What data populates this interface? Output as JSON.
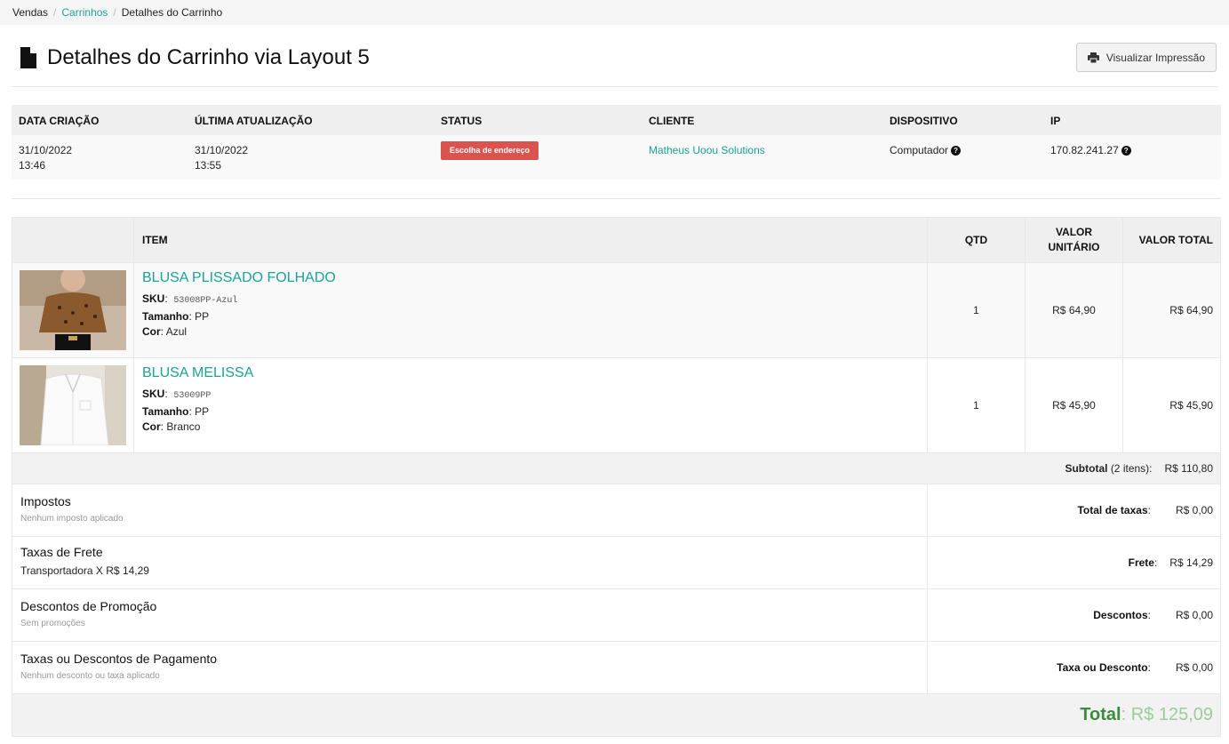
{
  "breadcrumb": {
    "item1": "Vendas",
    "item2": "Carrinhos",
    "item3": "Detalhes do Carrinho"
  },
  "header": {
    "title": "Detalhes do Carrinho via Layout 5",
    "print_label": "Visualizar Impressão",
    "title_icon": "file-icon",
    "print_icon": "printer-icon"
  },
  "info": {
    "headers": {
      "created": "DATA CRIAÇÃO",
      "updated": "ÚLTIMA ATUALIZAÇÃO",
      "status": "STATUS",
      "client": "CLIENTE",
      "device": "DISPOSITIVO",
      "ip": "IP"
    },
    "created_date": "31/10/2022",
    "created_time": "13:46",
    "updated_date": "31/10/2022",
    "updated_time": "13:55",
    "status": "Escolha de endereço",
    "status_color": "#d9534f",
    "client": "Matheus Uoou Solutions",
    "device": "Computador",
    "ip": "170.82.241.27"
  },
  "table": {
    "headers": {
      "item": "ITEM",
      "qtd": "QTD",
      "unit": "VALOR UNITÁRIO",
      "total": "VALOR TOTAL"
    },
    "items": [
      {
        "name": "BLUSA PLISSADO FOLHADO",
        "sku_label": "SKU",
        "sku": "53008PP-Azul",
        "size_label": "Tamanho",
        "size": "PP",
        "color_label": "Cor",
        "color": "Azul",
        "qtd": "1",
        "unit": "R$ 64,90",
        "total": "R$ 64,90"
      },
      {
        "name": "BLUSA MELISSA",
        "sku_label": "SKU",
        "sku": "53009PP",
        "size_label": "Tamanho",
        "size": "PP",
        "color_label": "Cor",
        "color": "Branco",
        "qtd": "1",
        "unit": "R$ 45,90",
        "total": "R$ 45,90"
      }
    ],
    "subtotal_label": "Subtotal",
    "subtotal_count": "(2 itens):",
    "subtotal": "R$ 110,80"
  },
  "summary": {
    "taxes": {
      "title": "Impostos",
      "sub": "Nenhum imposto aplicado",
      "label": "Total de taxas",
      "value": "R$ 0,00"
    },
    "freight": {
      "title": "Taxas de Frete",
      "sub": "Transportadora X R$ 14,29",
      "label": "Frete",
      "value": "R$ 14,29"
    },
    "promo": {
      "title": "Descontos de Promoção",
      "sub": "Sem promoções",
      "label": "Descontos",
      "value": "R$ 0,00"
    },
    "payment": {
      "title": "Taxas ou Descontos de Pagamento",
      "sub": "Nenhum desconto ou taxa aplicado",
      "label": "Taxa ou Desconto",
      "value": "R$ 0,00"
    },
    "total_label": "Total",
    "total_value": "R$ 125,09"
  },
  "colors": {
    "accent": "#1aa393",
    "total_green": "#3c8b3e"
  }
}
